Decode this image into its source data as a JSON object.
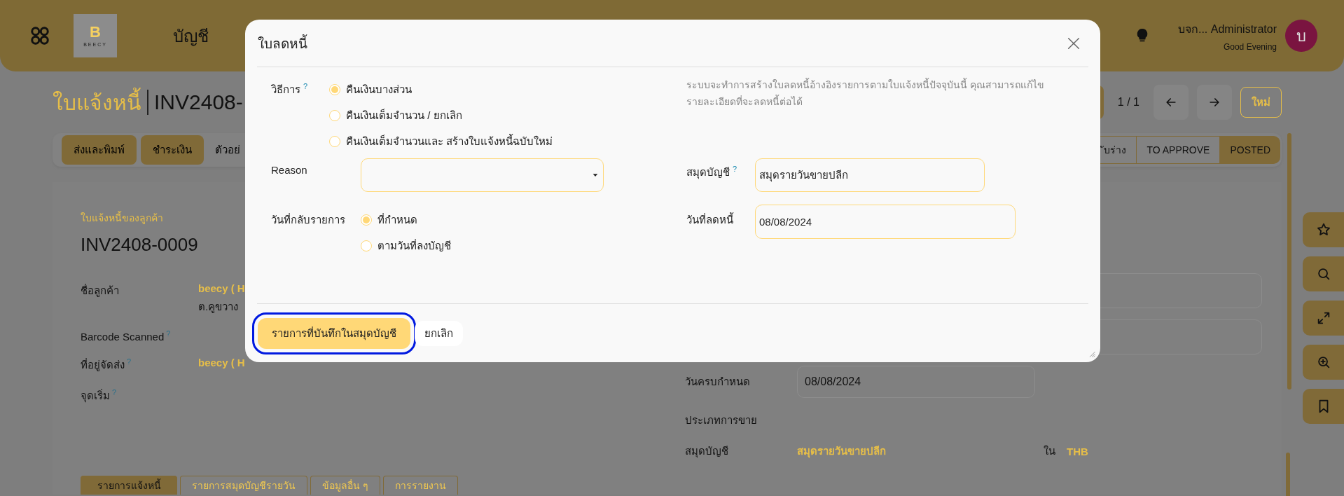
{
  "header": {
    "logo_mark": "B",
    "logo_word": "BEECY",
    "app_title": "บัญชี",
    "user_name": "บจก... Administrator",
    "greeting": "Good Evening",
    "avatar_letter": "บ"
  },
  "breadcrumb": {
    "parent": "ใบแจ้งหนี้",
    "current": "INV2408-"
  },
  "pager": {
    "counter": "1 / 1",
    "new_button": "ใหม่"
  },
  "actions": [
    {
      "label": "ส่งและพิมพ์",
      "kind": "filled"
    },
    {
      "label": "ชำระเงิน",
      "kind": "filled"
    },
    {
      "label": "ตัวอย่",
      "kind": "plain"
    }
  ],
  "status_steps": [
    {
      "label": "ับร่าง",
      "selected": false
    },
    {
      "label": "TO APPROVE",
      "selected": false
    },
    {
      "label": "POSTED",
      "selected": true
    }
  ],
  "form": {
    "subtitle": "ใบแจ้งหนี้ของลูกค้า",
    "number": "INV2408-0009",
    "left_fields": [
      {
        "label": "ชื่อลูกค้า",
        "value": "beecy ( H",
        "detail": "ต.คูขวาง"
      },
      {
        "label": "Barcode Scanned",
        "help": "?"
      },
      {
        "label": "ที่อยู่จัดส่ง",
        "help": "?",
        "value": "beecy ( H"
      },
      {
        "label": "จุดเริ่ม",
        "help": "?"
      }
    ],
    "right_fields": [
      {
        "label": "วันครบกำหนด",
        "kind": "input",
        "value": "08/08/2024"
      },
      {
        "label": "ประเภทการขาย",
        "kind": "empty"
      },
      {
        "label": "สมุดบัญชี",
        "kind": "link",
        "value": "สมุดรายวันขายปลีก",
        "currency_prefix": "ใน",
        "currency": "THB"
      }
    ]
  },
  "tabs": [
    {
      "label": "รายการแจ้งหนี้",
      "selected": true
    },
    {
      "label": "รายการสมุดบัญชีรายวัน",
      "selected": false
    },
    {
      "label": "ข้อมูลอื่น ๆ",
      "selected": false
    },
    {
      "label": "การรายงาน",
      "selected": false
    }
  ],
  "side_tools": [
    {
      "kind": "star"
    },
    {
      "kind": "search"
    },
    {
      "kind": "expand"
    },
    {
      "kind": "zoom"
    },
    {
      "kind": "bookmark"
    }
  ],
  "dialog": {
    "title": "ใบลดหนี้",
    "method": {
      "label": "วิธีการ",
      "help": "?",
      "options": [
        {
          "label": "คืนเงินบางส่วน",
          "selected": true
        },
        {
          "label": "คืนเงินเต็มจำนวน / ยกเลิก",
          "selected": false
        },
        {
          "label": "คืนเงินเต็มจำนวนและ สร้างใบแจ้งหนี้ฉบับใหม่",
          "selected": false
        }
      ]
    },
    "description": "ระบบจะทำการสร้างใบลดหนี้อ้างอิงรายการตามใบแจ้งหนี้ปัจจุบันนี้ คุณสามารถแก้ไขรายละเอียดที่จะลดหนี้ต่อได้",
    "reason": {
      "label": "Reason"
    },
    "journal": {
      "label": "สมุดบัญชี",
      "help": "?",
      "value": "สมุดรายวันขายปลีก"
    },
    "reversal_date": {
      "label": "วันที่กลับรายการ",
      "options": [
        {
          "label": "ที่กำหนด",
          "selected": true
        },
        {
          "label": "ตามวันที่ลงบัญชี",
          "selected": false
        }
      ]
    },
    "credit_date": {
      "label": "วันที่ลดหนี้",
      "value": "08/08/2024"
    },
    "buttons": [
      {
        "label": "รายการที่บันทึกในสมุดบัญชี",
        "kind": "primary",
        "focused": true
      },
      {
        "label": "ยกเลิก",
        "kind": "secondary",
        "focused": false
      }
    ]
  }
}
